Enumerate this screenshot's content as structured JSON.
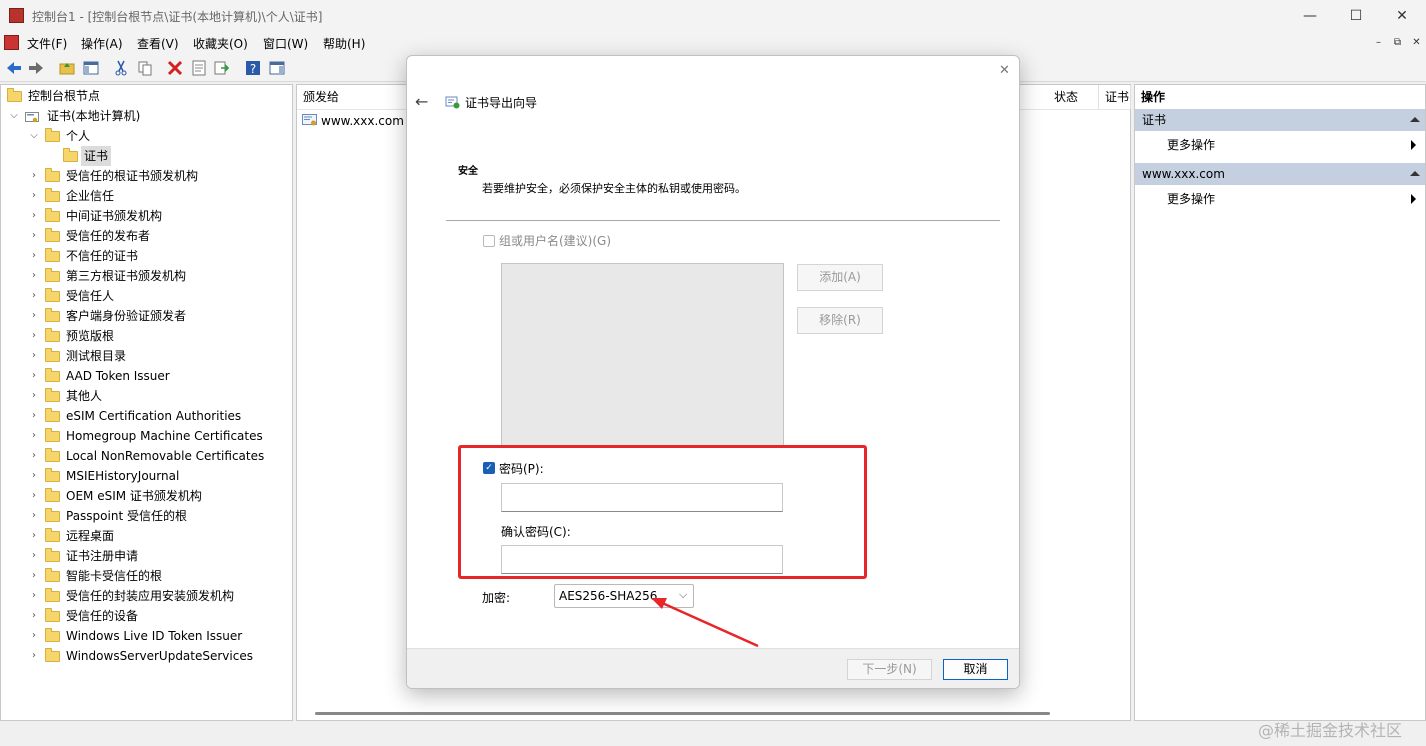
{
  "window": {
    "title": "控制台1 - [控制台根节点\\证书(本地计算机)\\个人\\证书]",
    "controls": {
      "minimize": "—",
      "maximize": "☐",
      "close": "✕"
    }
  },
  "menubar": {
    "items": [
      "文件(F)",
      "操作(A)",
      "查看(V)",
      "收藏夹(O)",
      "窗口(W)",
      "帮助(H)"
    ],
    "mdi_controls": [
      "–",
      "⧉",
      "✕"
    ]
  },
  "toolbar": {
    "icons": [
      "back-arrow-icon",
      "forward-arrow-icon",
      "up-folder-icon",
      "show-hide-tree-icon",
      "cut-icon",
      "copy-icon",
      "delete-icon",
      "properties-icon",
      "export-list-icon",
      "help-icon",
      "show-hide-action-pane-icon"
    ]
  },
  "tree": {
    "root": "控制台根节点",
    "computer": "证书(本地计算机)",
    "personal": "个人",
    "selected": "证书",
    "stores": [
      "受信任的根证书颁发机构",
      "企业信任",
      "中间证书颁发机构",
      "受信任的发布者",
      "不信任的证书",
      "第三方根证书颁发机构",
      "受信任人",
      "客户端身份验证颁发者",
      "预览版根",
      "测试根目录",
      "AAD Token Issuer",
      "其他人",
      "eSIM Certification Authorities",
      "Homegroup Machine Certificates",
      "Local NonRemovable Certificates",
      "MSIEHistoryJournal",
      "OEM eSIM 证书颁发机构",
      "Passpoint 受信任的根",
      "远程桌面",
      "证书注册申请",
      "智能卡受信任的根",
      "受信任的封装应用安装颁发机构",
      "受信任的设备",
      "Windows Live ID Token Issuer",
      "WindowsServerUpdateServices"
    ]
  },
  "list": {
    "columns": {
      "issued_to": "颁发给",
      "status": "状态",
      "cert": "证书"
    },
    "rows": [
      {
        "issued_to": "www.xxx.com"
      }
    ]
  },
  "actions": {
    "header": "操作",
    "groups": [
      {
        "title": "证书",
        "item": "更多操作"
      },
      {
        "title": "www.xxx.com",
        "item": "更多操作"
      }
    ]
  },
  "dialog": {
    "title": "证书导出向导",
    "section_title": "安全",
    "section_desc": "若要维护安全，必须保护安全主体的私钥或使用密码。",
    "group_checkbox_label": "组或用户名(建议)(G)",
    "add_button": "添加(A)",
    "remove_button": "移除(R)",
    "password_label": "密码(P):",
    "password_checked": true,
    "password_value": "",
    "confirm_label": "确认密码(C):",
    "confirm_value": "",
    "encryption_label": "加密:",
    "encryption_value": "AES256-SHA256",
    "next_button": "下一步(N)",
    "cancel_button": "取消",
    "close": "✕",
    "back": "←"
  },
  "annotation": {
    "highlight_color": "#e8262a",
    "arrow_color": "#e8262a"
  },
  "watermark": "@稀土掘金技术社区"
}
